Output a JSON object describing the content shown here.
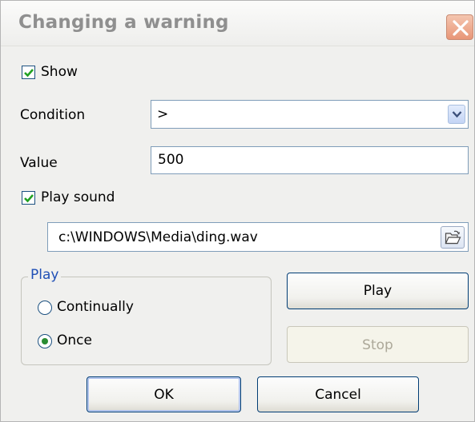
{
  "window": {
    "title": "Changing a warning",
    "close_icon": "close-x-icon"
  },
  "show": {
    "label": "Show",
    "checked": true
  },
  "condition": {
    "label": "Condition",
    "value": ">",
    "dropdown_icon": "chevron-down-icon"
  },
  "value_field": {
    "label": "Value",
    "value": "500"
  },
  "play_sound": {
    "label": "Play sound",
    "checked": true
  },
  "sound_file": {
    "value": "c:\\WINDOWS\\Media\\ding.wav",
    "browse_icon": "open-folder-icon"
  },
  "play_group": {
    "legend": "Play",
    "options": [
      {
        "label": "Continually",
        "selected": false
      },
      {
        "label": "Once",
        "selected": true
      }
    ]
  },
  "buttons": {
    "play": "Play",
    "stop": "Stop",
    "ok": "OK",
    "cancel": "Cancel"
  }
}
